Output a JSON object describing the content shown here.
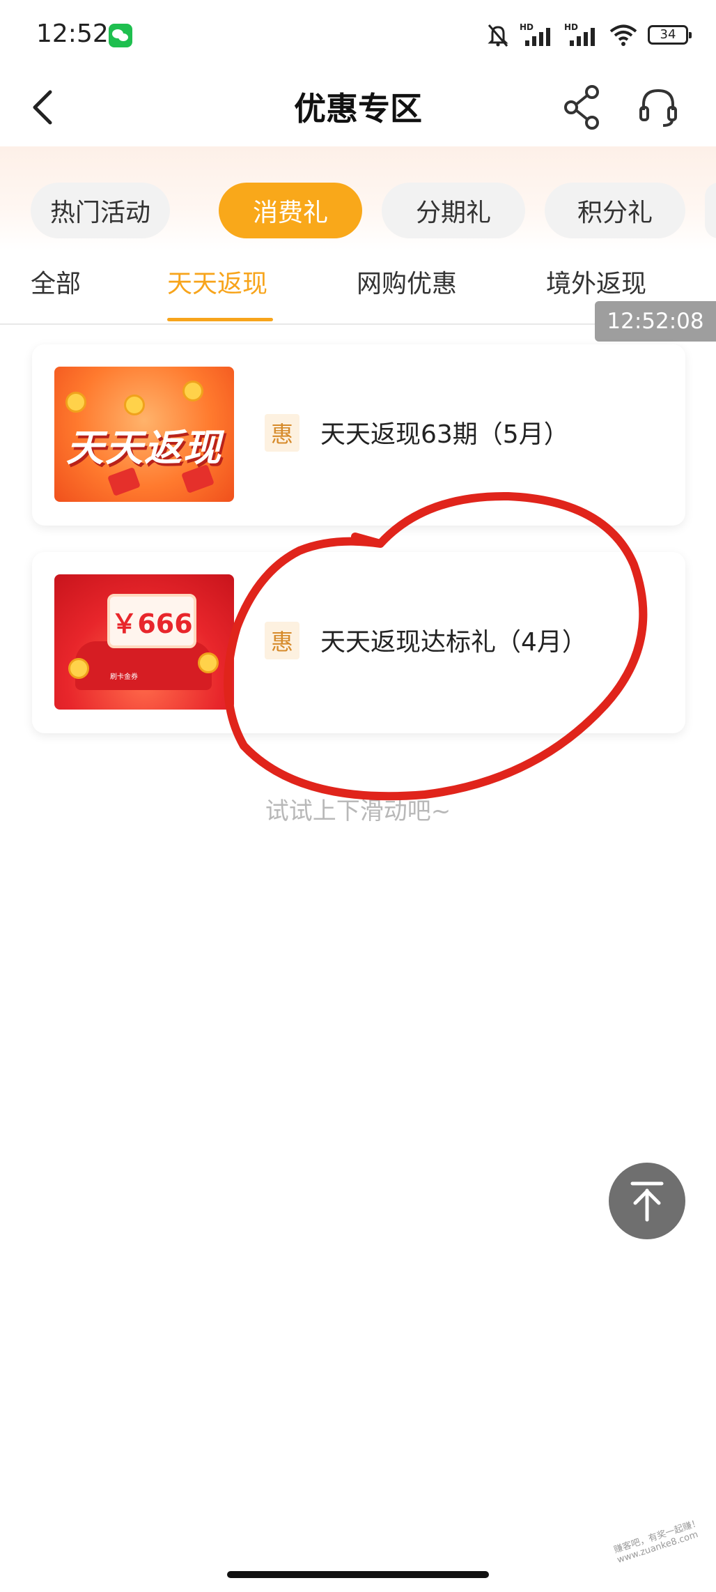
{
  "status_bar": {
    "time": "12:52",
    "network_label": "HD",
    "battery": "34"
  },
  "header": {
    "title": "优惠专区"
  },
  "categories": [
    {
      "label": "热门活动",
      "active": false
    },
    {
      "label": "消费礼",
      "active": true
    },
    {
      "label": "分期礼",
      "active": false
    },
    {
      "label": "积分礼",
      "active": false
    }
  ],
  "subtabs": [
    {
      "label": "全部",
      "active": false
    },
    {
      "label": "天天返现",
      "active": true
    },
    {
      "label": "网购优惠",
      "active": false
    },
    {
      "label": "境外返现",
      "active": false
    }
  ],
  "screenshot_timestamp": "12:52:08",
  "activities": [
    {
      "badge": "惠",
      "title": "天天返现63期（5月）",
      "image_text": "天天返现"
    },
    {
      "badge": "惠",
      "title": "天天返现达标礼（4月）",
      "image_text": "￥666",
      "image_sublabel": "刷卡金券"
    }
  ],
  "hint": "试试上下滑动吧~",
  "watermark": "赚客吧，有奖一起赚！ www.zuanke8.com",
  "colors": {
    "accent": "#f9a81a",
    "active_tab": "#f7a41b",
    "annotation": "#e0241b"
  },
  "icons": {
    "back": "back-arrow-icon",
    "share": "share-icon",
    "service": "headset-icon",
    "scroll_top": "arrow-up-icon"
  }
}
